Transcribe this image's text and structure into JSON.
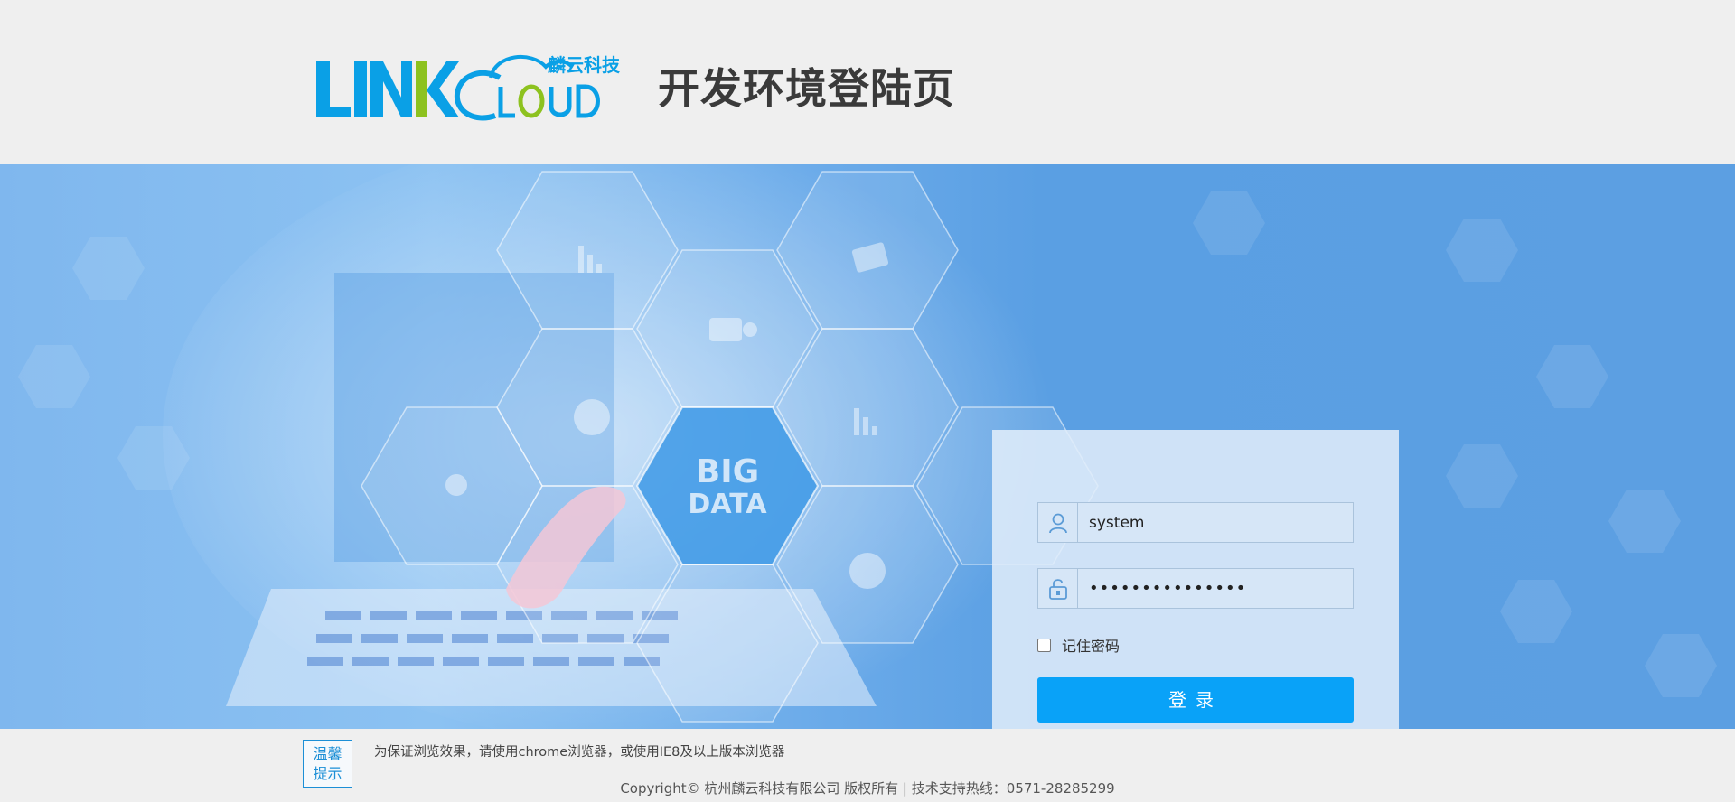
{
  "header": {
    "logo_text": "LINKCLOUD",
    "logo_cn": "麟云科技",
    "page_title": "开发环境登陆页"
  },
  "banner": {
    "center_label_line1": "BIG",
    "center_label_line2": "DATA"
  },
  "login": {
    "username_value": "system",
    "password_value": "•••••••••••••••",
    "remember_label": "记住密码",
    "remember_checked": false,
    "submit_label": "登录"
  },
  "footer": {
    "tip_badge_line1": "温馨",
    "tip_badge_line2": "提示",
    "tip_text": "为保证浏览效果，请使用chrome浏览器，或使用IE8及以上版本浏览器",
    "copyright": "Copyright© 杭州麟云科技有限公司 版权所有 | 技术支持热线：0571-28285299"
  },
  "colors": {
    "accent": "#09a2f8",
    "logo_blue": "#0aa0e6",
    "logo_green": "#8dc21f",
    "title": "#3a3a3a"
  },
  "icons": {
    "username": "user-icon",
    "password": "unlock-icon"
  }
}
